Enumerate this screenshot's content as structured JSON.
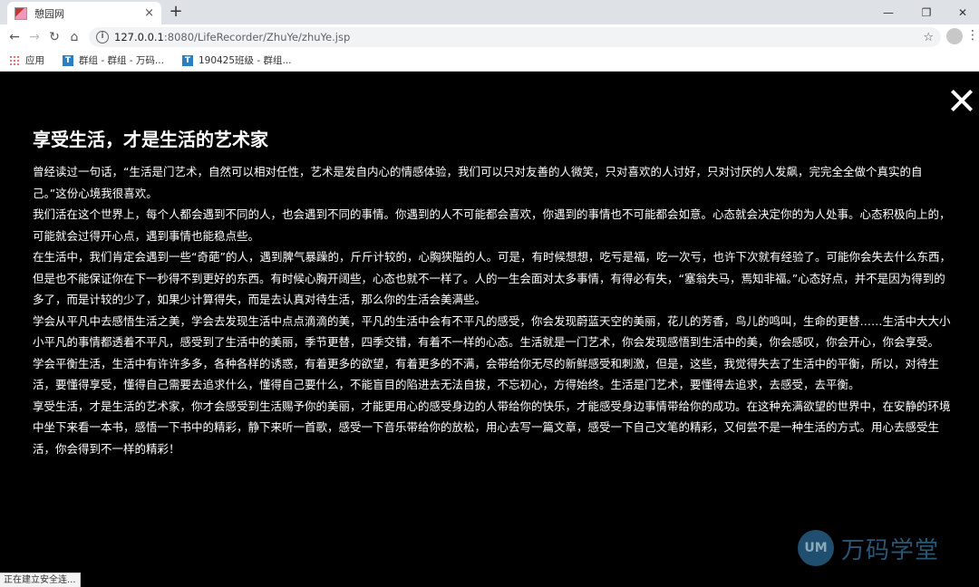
{
  "browser": {
    "tab_title": "憩园网",
    "tab_close": "×",
    "new_tab": "+",
    "url_host": "127.0.0.1",
    "url_path": ":8080/LifeRecorder/ZhuYe/zhuYe.jsp",
    "bookmarks": [
      {
        "label": "应用"
      },
      {
        "label": "群组 - 群组 - 万码..."
      },
      {
        "label": "190425班级 - 群组..."
      }
    ],
    "status_text": "正在建立安全连..."
  },
  "article": {
    "title": "享受生活，才是生活的艺术家",
    "paragraphs": [
      "曾经读过一句话，“生活是门艺术，自然可以相对任性，艺术是发自内心的情感体验，我们可以只对友善的人微笑，只对喜欢的人讨好，只对讨厌的人发飙，完完全全做个真实的自己。”这份心境我很喜欢。",
      "我们活在这个世界上，每个人都会遇到不同的人，也会遇到不同的事情。你遇到的人不可能都会喜欢，你遇到的事情也不可能都会如意。心态就会决定你的为人处事。心态积极向上的，可能就会过得开心点，遇到事情也能稳点些。",
      "在生活中，我们肯定会遇到一些“奇葩”的人，遇到脾气暴躁的，斤斤计较的，心胸狭隘的人。可是，有时候想想，吃亏是福，吃一次亏，也许下次就有经验了。可能你会失去什么东西，但是也不能保证你在下一秒得不到更好的东西。有时候心胸开阔些，心态也就不一样了。人的一生会面对太多事情，有得必有失，“塞翁失马，焉知非福。”心态好点，并不是因为得到的多了，而是计较的少了，如果少计算得失，而是去认真对待生活，那么你的生活会美满些。",
      "学会从平凡中去感悟生活之美，学会去发现生活中点点滴滴的美，平凡的生活中会有不平凡的感受，你会发现蔚蓝天空的美丽，花儿的芳香，鸟儿的鸣叫，生命的更替……生活中大大小小平凡的事情都透着不平凡，感受到了生活中的美丽，季节更替，四季交错，有着不一样的心态。生活就是一门艺术，你会发现感悟到生活中的美，你会感叹，你会开心，你会享受。",
      "学会平衡生活，生活中有许许多多，各种各样的诱惑，有着更多的欲望，有着更多的不满，会带给你无尽的新鲜感受和刺激，但是，这些，我觉得失去了生活中的平衡，所以，对待生活，要懂得享受，懂得自己需要去追求什么，懂得自己要什么，不能盲目的陷进去无法自拔，不忘初心，方得始终。生活是门艺术，要懂得去追求，去感受，去平衡。",
      "享受生活，才是生活的艺术家，你才会感受到生活赐予你的美丽，才能更用心的感受身边的人带给你的快乐，才能感受身边事情带给你的成功。在这种充满欲望的世界中，在安静的环境中坐下来看一本书，感悟一下书中的精彩，静下来听一首歌，感受一下音乐带给你的放松，用心去写一篇文章，感受一下自己文笔的精彩，又何尝不是一种生活的方式。用心去感受生活，你会得到不一样的精彩！"
    ]
  },
  "watermark": {
    "logo": "UM",
    "text": "万码学堂"
  }
}
